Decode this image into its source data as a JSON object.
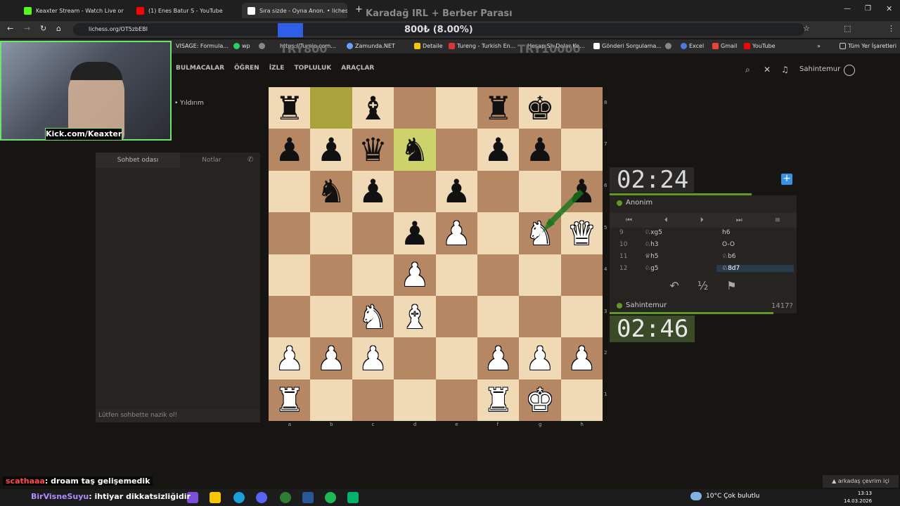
{
  "browser": {
    "tabs": [
      {
        "label": "Keaxter Stream - Watch Live on",
        "favicon_color": "#53fc18"
      },
      {
        "label": "(1) Enes Batur S - YouTube",
        "favicon_color": "#ff0000"
      },
      {
        "label": "Sıra sizde - Oyna Anon. • liches",
        "favicon_color": "#ffffff"
      }
    ],
    "new_tab": "+",
    "url": "lichess.org/OT5zbEBI",
    "bookmarks": [
      "VISAGE: Formula...",
      "wp",
      "",
      "https://Turnio.com...",
      "Zamunda.NET",
      "Detaile",
      "Tureng - Turkish En...",
      "Hesap Sh Dolar Ke...",
      "Gönderi Sorgulama...",
      "",
      "Excel",
      "Gmail",
      "YouTube"
    ],
    "bookmarks_more": "»",
    "all_bookmarks": "Tüm Yer İşaretleri"
  },
  "stream_overlay": {
    "title": "Karadağ IRL + Berber Parası",
    "percent": "800₺ (8.00%)",
    "try_left": "TRY800",
    "try_right": "TRY10000",
    "kick": "Kick.com/Keaxter",
    "chat": [
      {
        "user": "scathaaa",
        "msg": ": droam taş gelişemedik",
        "color": "#ff4d4d"
      },
      {
        "user": "BirVisneSuyu",
        "msg": ": ihtiyar dikkatsizliğidir",
        "color": "#9b6bff"
      }
    ]
  },
  "lichess": {
    "nav": [
      "BULMACALAR",
      "ÖĞREN",
      "İZLE",
      "TOPLULUK",
      "ARAÇLAR"
    ],
    "username": "Sahintemur",
    "variant": "• Yıldırım",
    "chat_tabs": [
      "Sohbet odası",
      "Notlar"
    ],
    "chat_placeholder": "Lütfen sohbette nazik ol!",
    "opponent": {
      "name": "Anonim",
      "clock": "02:24"
    },
    "player": {
      "name": "Sahintemur",
      "rating": "1417?",
      "clock": "02:46"
    },
    "moves": [
      {
        "num": "9",
        "white": "♘xg5",
        "black": "h6"
      },
      {
        "num": "10",
        "white": "♘h3",
        "black": "O-O"
      },
      {
        "num": "11",
        "white": "♕h5",
        "black": "♘b6"
      },
      {
        "num": "12",
        "white": "♘g5",
        "black": "♘8d7"
      }
    ],
    "action_icons": [
      "takeback-icon",
      "draw-icon",
      "resign-icon"
    ],
    "action_labels": [
      "↶",
      "½",
      "⚑"
    ],
    "files": [
      "a",
      "b",
      "c",
      "d",
      "e",
      "f",
      "g",
      "h"
    ],
    "ranks": [
      "8",
      "7",
      "6",
      "5",
      "4",
      "3",
      "2",
      "1"
    ],
    "position": [
      [
        "r",
        "",
        "b",
        "",
        "",
        "r",
        "k",
        ""
      ],
      [
        "p",
        "p",
        "q",
        "n",
        "",
        "p",
        "p",
        ""
      ],
      [
        "",
        "n",
        "p",
        "",
        "p",
        "",
        "",
        "p"
      ],
      [
        "",
        "",
        "",
        "p",
        "P",
        "",
        "N",
        "Q"
      ],
      [
        "",
        "",
        "",
        "P",
        "",
        "",
        "",
        ""
      ],
      [
        "",
        "",
        "N",
        "B",
        "",
        "",
        "",
        ""
      ],
      [
        "P",
        "P",
        "P",
        "",
        "",
        "P",
        "P",
        "P"
      ],
      [
        "R",
        "",
        "",
        "",
        "",
        "R",
        "K",
        ""
      ]
    ],
    "highlight": [
      "b8",
      "d7"
    ]
  },
  "taskbar": {
    "weather": "10°C  Çok bulutlu",
    "time": "13:13",
    "date": "14.03.2026",
    "friends": "▲ arkadaş çevrim içi"
  }
}
